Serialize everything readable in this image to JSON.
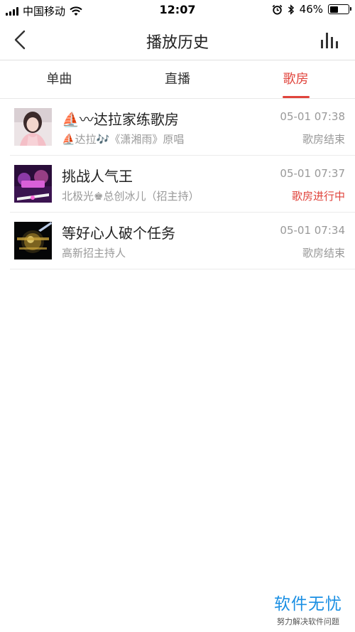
{
  "status_bar": {
    "carrier": "中国移动",
    "time": "12:07",
    "battery": "46%",
    "battery_level": 0.46
  },
  "nav": {
    "title": "播放历史",
    "back_icon": "chevron-left-icon",
    "right_icon": "bar-chart-icon"
  },
  "tabs": [
    {
      "label": "单曲",
      "active": false
    },
    {
      "label": "直播",
      "active": false
    },
    {
      "label": "歌房",
      "active": true
    }
  ],
  "items": [
    {
      "title": "⛵〰达拉家练歌房",
      "subtitle": "⛵达拉🎶《潇湘雨》原唱",
      "time": "05-01 07:38",
      "status": "歌房结束",
      "live": false
    },
    {
      "title": "挑战人气王",
      "subtitle": "北极光♚总创冰儿（招主持）",
      "time": "05-01 07:37",
      "status": "歌房进行中",
      "live": true
    },
    {
      "title": "等好心人破个任务",
      "subtitle": "高新招主持人",
      "time": "05-01 07:34",
      "status": "歌房结束",
      "live": false
    }
  ],
  "watermark": {
    "title": "软件无忧",
    "subtitle": "努力解决软件问题"
  },
  "colors": {
    "accent": "#e0443c",
    "watermark": "#1a8fe3"
  }
}
